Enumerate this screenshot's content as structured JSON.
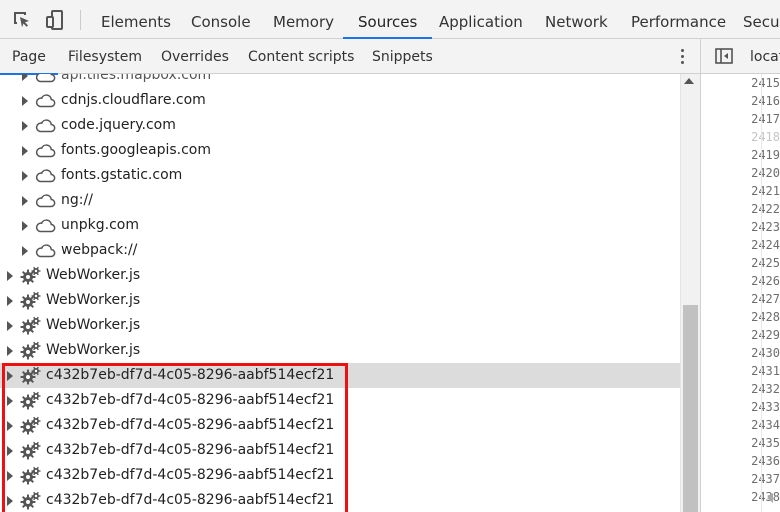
{
  "toolbar": {
    "tabs": [
      "Elements",
      "Console",
      "Memory",
      "Sources",
      "Application",
      "Network",
      "Performance",
      "Secur"
    ],
    "active_tab": "Sources"
  },
  "navigator": {
    "tabs": [
      "Page",
      "Filesystem",
      "Overrides",
      "Content scripts",
      "Snippets"
    ],
    "active_tab": "Page"
  },
  "tree": {
    "domains": [
      "api.tiles.mapbox.com",
      "cdnjs.cloudflare.com",
      "code.jquery.com",
      "fonts.googleapis.com",
      "fonts.gstatic.com",
      "ng://",
      "unpkg.com",
      "webpack://"
    ],
    "workers": [
      "WebWorker.js",
      "WebWorker.js",
      "WebWorker.js",
      "WebWorker.js",
      "c432b7eb-df7d-4c05-8296-aabf514ecf21",
      "c432b7eb-df7d-4c05-8296-aabf514ecf21",
      "c432b7eb-df7d-4c05-8296-aabf514ecf21",
      "c432b7eb-df7d-4c05-8296-aabf514ecf21",
      "c432b7eb-df7d-4c05-8296-aabf514ecf21",
      "c432b7eb-df7d-4c05-8296-aabf514ecf21"
    ],
    "selected_worker": 4,
    "icons": {
      "domain": "cloud-icon",
      "worker": "gear-icon"
    }
  },
  "editor": {
    "tab_label": "locat",
    "line_numbers": [
      "2415",
      "2416",
      "2417",
      "2418",
      "2419",
      "2420",
      "2421",
      "2422",
      "2423",
      "2424",
      "2425",
      "2426",
      "2427",
      "2428",
      "2429",
      "2430",
      "2431",
      "2432",
      "2433",
      "2434",
      "2435",
      "2436",
      "2437",
      "2438"
    ],
    "dim_line": "2418"
  },
  "colors": {
    "accent": "#1a73e8",
    "highlight": "#ee1111",
    "selected_row": "#dcdcdc"
  }
}
